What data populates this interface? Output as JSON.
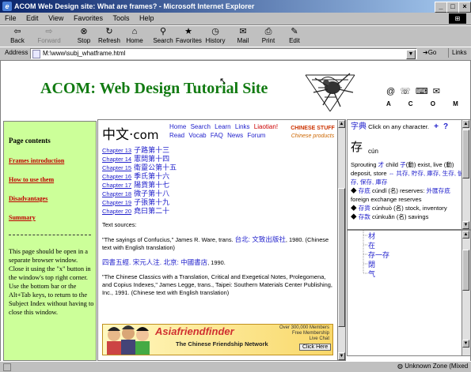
{
  "window": {
    "title": "ACOM Web Design site: What are frames? - Microsoft Internet Explorer",
    "controls": [
      "_",
      "□",
      "×"
    ]
  },
  "menu": [
    "File",
    "Edit",
    "View",
    "Favorites",
    "Tools",
    "Help"
  ],
  "toolbar": [
    {
      "label": "Back",
      "icon": "back-arrow"
    },
    {
      "label": "Forward",
      "icon": "forward-arrow",
      "disabled": true
    },
    {
      "label": "Stop",
      "icon": "stop"
    },
    {
      "label": "Refresh",
      "icon": "refresh"
    },
    {
      "label": "Home",
      "icon": "home"
    },
    {
      "label": "Search",
      "icon": "search"
    },
    {
      "label": "Favorites",
      "icon": "favorites"
    },
    {
      "label": "History",
      "icon": "history"
    },
    {
      "label": "Mail",
      "icon": "mail"
    },
    {
      "label": "Print",
      "icon": "print"
    },
    {
      "label": "Edit",
      "icon": "edit"
    }
  ],
  "address": {
    "label": "Address",
    "value": "M:\\www\\subj_whatframe.html",
    "go": "Go",
    "links": "Links"
  },
  "banner": {
    "title": "ACOM: Web Design Tutorial Site",
    "logo_text": "A C O M"
  },
  "left_frame": {
    "heading": "Page contents",
    "links": [
      "Frames introduction",
      "How to use them",
      "Disadvantages",
      "Summary"
    ],
    "note": "This page should be open in a separate browser window. Close it using the \"x\" button in the window's top right corner. Use the bottom bar or the Alt+Tab keys, to return to the Subject Index without having to close this window."
  },
  "middle_frame": {
    "logo_chinese": "中文",
    "logo_dot": "·",
    "logo_com": "com",
    "nav_row1": [
      "Home",
      "Search",
      "Learn",
      "Links",
      "Liaotian!"
    ],
    "nav_row2": [
      "Read",
      "Vocab",
      "FAQ",
      "News",
      "Forum"
    ],
    "chinese_products": [
      "CHINESE STUFF",
      "Chinese products"
    ],
    "chapters": [
      {
        "num": "Chapter 13",
        "zh": "子路第十三"
      },
      {
        "num": "Chapter 14",
        "zh": "憲問第十四"
      },
      {
        "num": "Chapter 15",
        "zh": "衛靈公第十五"
      },
      {
        "num": "Chapter 16",
        "zh": "季氏第十六"
      },
      {
        "num": "Chapter 17",
        "zh": "陽貨第十七"
      },
      {
        "num": "Chapter 18",
        "zh": "微子第十八"
      },
      {
        "num": "Chapter 19",
        "zh": "子張第十九"
      },
      {
        "num": "Chapter 20",
        "zh": "堯曰第二十"
      }
    ],
    "text_sources_label": "Text sources:",
    "source1_a": "\"The sayings of Confucius,\" James R. Ware, trans.",
    "source1_b": "台北: 文致出版社",
    "source1_c": ", 1980. (Chinese text with English translation)",
    "source2_zh": "四書五經. 宋元人注. 北京: 中國書店",
    "source2_tail": ", 1990.",
    "source3": "\"The Chinese Classics with a Translation, Critical and Exegetical Notes, Prolegomena, and Copius Indexes,\" James Legge, trans., Taipei: Southern Materials Center Publishing, Inc., 1991. (Chinese text with English translation)",
    "ad": {
      "brand": "Asiafriendfinder",
      "tagline": "The Chinese Friendship Network",
      "lines": [
        "Over 300,000 Members",
        "Free Membership",
        "Live Chat"
      ],
      "button": "Click Here"
    }
  },
  "right_top": {
    "dict_label": "字典",
    "instruction": "Click on any character.",
    "plus": "+",
    "question": "?",
    "big_char": "存",
    "pinyin": "cún",
    "definition_a": "Sprouting",
    "definition_b": "才",
    "definition_c": "child",
    "definition_d": "子",
    "definition_e": "(動) exist, live (動) deposit, store",
    "definition_f": "⇔ 共存, 貯存, 庫存, 生存, 儲存, 保存, 庫存",
    "entries": [
      {
        "zh": "存底",
        "py": "cúndǐ",
        "pos": "(名)",
        "gloss": "reserves:",
        "zh2": "外匯存底",
        "gloss2": "foreign exchange reserves"
      },
      {
        "zh": "存貨",
        "py": "cúnhuò",
        "pos": "(名)",
        "gloss": "stock, inventory"
      },
      {
        "zh": "存款",
        "py": "cúnkuǎn",
        "pos": "(名)",
        "gloss": "savings"
      }
    ]
  },
  "right_bottom": {
    "items": [
      "材",
      "在",
      "存一存",
      "閉",
      "气"
    ]
  },
  "status": {
    "zone": "Unknown Zone (Mixed"
  }
}
